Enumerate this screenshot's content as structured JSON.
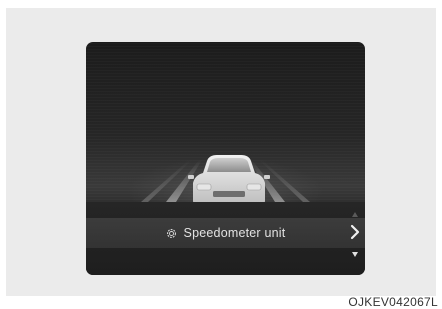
{
  "menu": {
    "icon": "gear-icon",
    "label": "Speedometer unit",
    "next_icon": "chevron-right-icon",
    "scroll_up_icon": "triangle-up-icon",
    "scroll_down_icon": "triangle-down-icon"
  },
  "figure_code": "OJKEV042067L",
  "colors": {
    "screen_background": "#262626",
    "menu_bar": "#383838",
    "text": "#e2e2e2",
    "frame": "#ebebeb"
  }
}
